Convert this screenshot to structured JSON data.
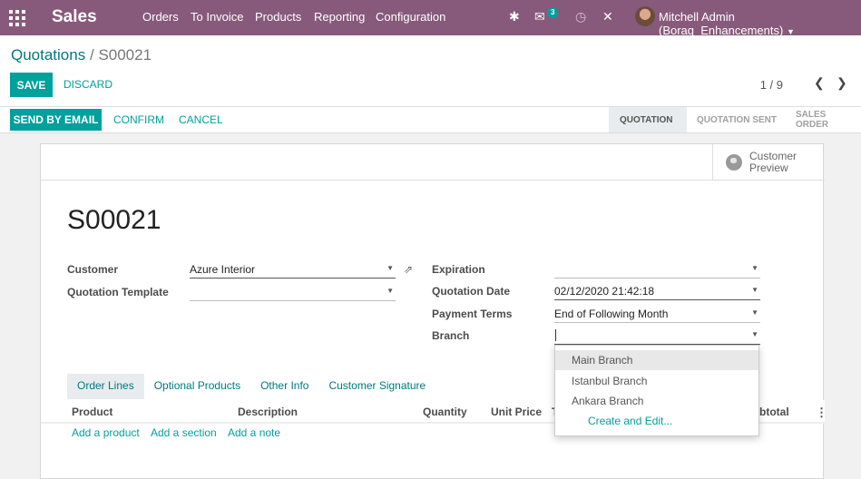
{
  "navbar": {
    "app_name": "Sales",
    "menu": [
      "Orders",
      "To Invoice",
      "Products",
      "Reporting",
      "Configuration"
    ],
    "messages_count": "3",
    "user_name": "Mitchell Admin (Boraq_Enhancements)"
  },
  "breadcrumb": {
    "parent": "Quotations",
    "separator": "/",
    "current": "S00021"
  },
  "actions": {
    "save": "Save",
    "discard": "Discard"
  },
  "pager": {
    "value": "1 / 9"
  },
  "header_buttons": {
    "send_email": "Send by Email",
    "confirm": "Confirm",
    "cancel": "Cancel"
  },
  "status_stages": [
    "Quotation",
    "Quotation Sent",
    "Sales Order"
  ],
  "status_active": "Quotation",
  "smart_button": {
    "line1": "Customer",
    "line2": "Preview"
  },
  "record": {
    "name": "S00021"
  },
  "fields": {
    "customer": {
      "label": "Customer",
      "value": "Azure Interior"
    },
    "quotation_template": {
      "label": "Quotation Template",
      "value": ""
    },
    "expiration": {
      "label": "Expiration",
      "value": ""
    },
    "quotation_date": {
      "label": "Quotation Date",
      "value": "02/12/2020 21:42:18"
    },
    "payment_terms": {
      "label": "Payment Terms",
      "value": "End of Following Month"
    },
    "branch": {
      "label": "Branch",
      "value": ""
    }
  },
  "tabs": [
    "Order Lines",
    "Optional Products",
    "Other Info",
    "Customer Signature"
  ],
  "table": {
    "columns": [
      "Product",
      "Description",
      "Quantity",
      "Unit Price",
      "T",
      "btotal"
    ],
    "add_links": [
      "Add a product",
      "Add a section",
      "Add a note"
    ]
  },
  "branch_dropdown": {
    "options": [
      "Main Branch",
      "Istanbul Branch",
      "Ankara Branch"
    ],
    "create_edit": "Create and Edit..."
  },
  "colors": {
    "brand": "#875a7b",
    "primary": "#00a09d",
    "link": "#00787d"
  }
}
